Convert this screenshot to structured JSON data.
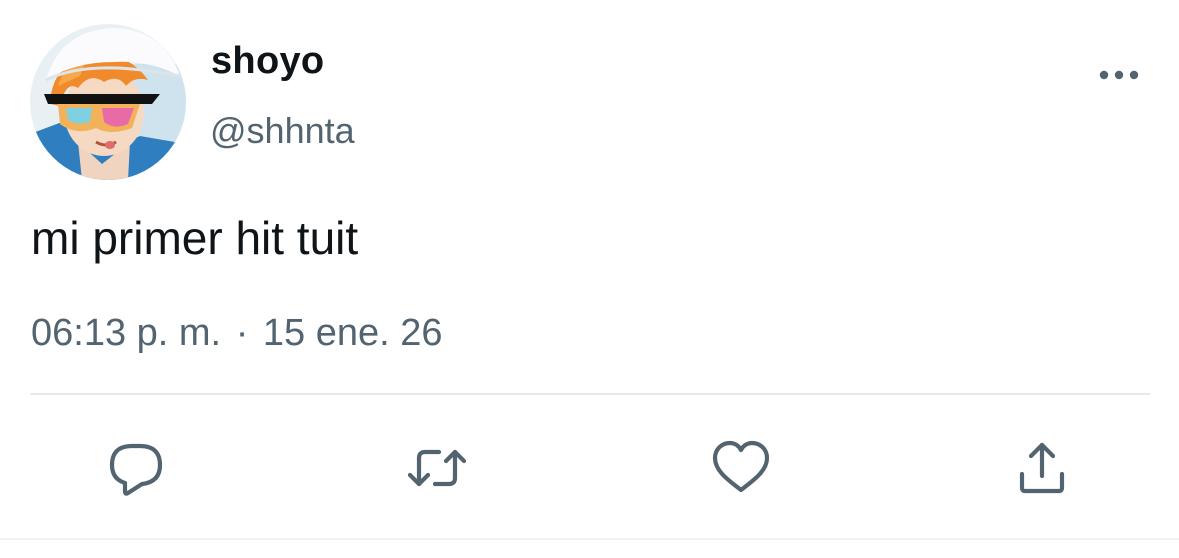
{
  "tweet": {
    "display_name": "shoyo",
    "handle": "@shhnta",
    "text": "mi primer hit tuit",
    "time": "06:13 p. m.",
    "separator": "·",
    "date": "15 ene. 26"
  },
  "header": {
    "more_icon": "more-horizontal-icon"
  },
  "actions": [
    {
      "name": "reply",
      "icon": "comment-bubble-icon"
    },
    {
      "name": "retweet",
      "icon": "retweet-arrows-icon"
    },
    {
      "name": "like",
      "icon": "heart-icon"
    },
    {
      "name": "share",
      "icon": "share-upload-icon"
    }
  ],
  "colors": {
    "text_primary": "#0f1419",
    "text_secondary": "#536471",
    "icon": "#536471",
    "divider": "#e6e9eb"
  }
}
